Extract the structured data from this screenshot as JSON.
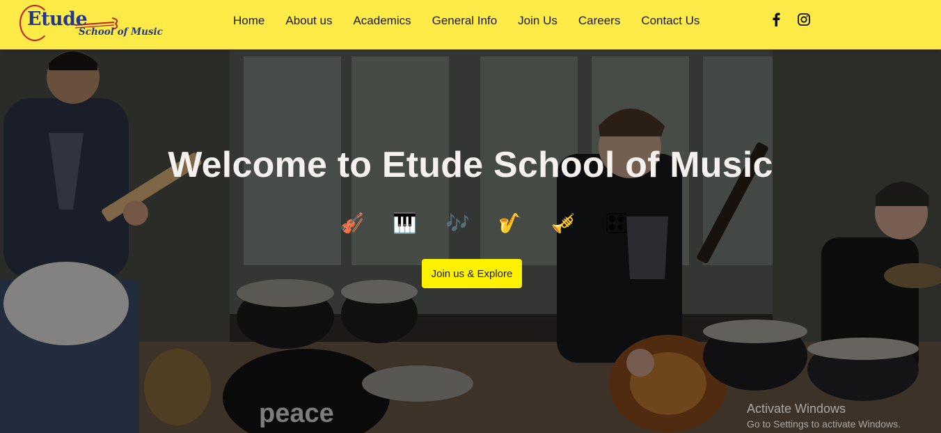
{
  "brand": {
    "logo_main": "Etude",
    "logo_sub": "School of Music"
  },
  "nav": {
    "items": [
      {
        "label": "Home"
      },
      {
        "label": "About us"
      },
      {
        "label": "Academics"
      },
      {
        "label": "General Info"
      },
      {
        "label": "Join Us"
      },
      {
        "label": "Careers"
      },
      {
        "label": "Contact Us"
      }
    ]
  },
  "social": {
    "icons": [
      "facebook-icon",
      "instagram-icon"
    ]
  },
  "hero": {
    "title": "Welcome to Etude School of Music",
    "instruments": [
      {
        "icon": "violin-icon",
        "glyph": "🎻"
      },
      {
        "icon": "piano-icon",
        "glyph": "🎹"
      },
      {
        "icon": "flute-icon",
        "glyph": "🎶"
      },
      {
        "icon": "saxophone-icon",
        "glyph": "🎷"
      },
      {
        "icon": "trumpet-icon",
        "glyph": "🎺"
      },
      {
        "icon": "keyboard-icon",
        "glyph": "🎛"
      }
    ],
    "cta_label": "Join us & Explore",
    "background_text": "peace"
  },
  "watermark": {
    "title": "Activate Windows",
    "subtitle": "Go to Settings to activate Windows."
  },
  "colors": {
    "header_bg": "#ffeb47",
    "cta_bg": "#fff200",
    "logo_blue": "#233a8c",
    "logo_red": "#c01f1f"
  }
}
